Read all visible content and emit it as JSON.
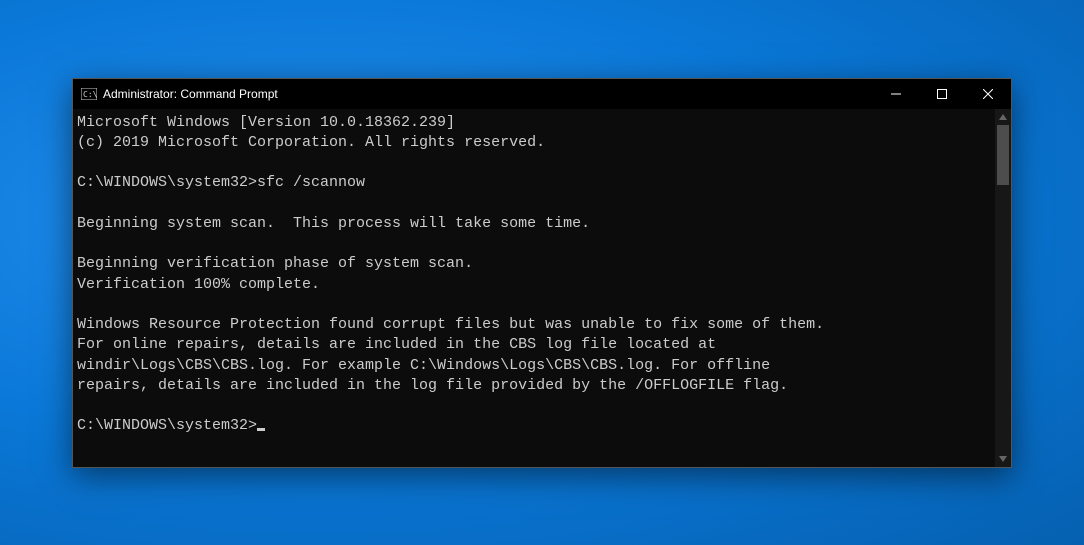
{
  "window": {
    "title": "Administrator: Command Prompt"
  },
  "terminal": {
    "lines": {
      "l0": "Microsoft Windows [Version 10.0.18362.239]",
      "l1": "(c) 2019 Microsoft Corporation. All rights reserved.",
      "prompt1_path": "C:\\WINDOWS\\system32>",
      "prompt1_cmd": "sfc /scannow",
      "l2": "Beginning system scan.  This process will take some time.",
      "l3": "Beginning verification phase of system scan.",
      "l4": "Verification 100% complete.",
      "l5": "Windows Resource Protection found corrupt files but was unable to fix some of them.",
      "l6": "For online repairs, details are included in the CBS log file located at",
      "l7": "windir\\Logs\\CBS\\CBS.log. For example C:\\Windows\\Logs\\CBS\\CBS.log. For offline",
      "l8": "repairs, details are included in the log file provided by the /OFFLOGFILE flag.",
      "prompt2_path": "C:\\WINDOWS\\system32>"
    }
  }
}
